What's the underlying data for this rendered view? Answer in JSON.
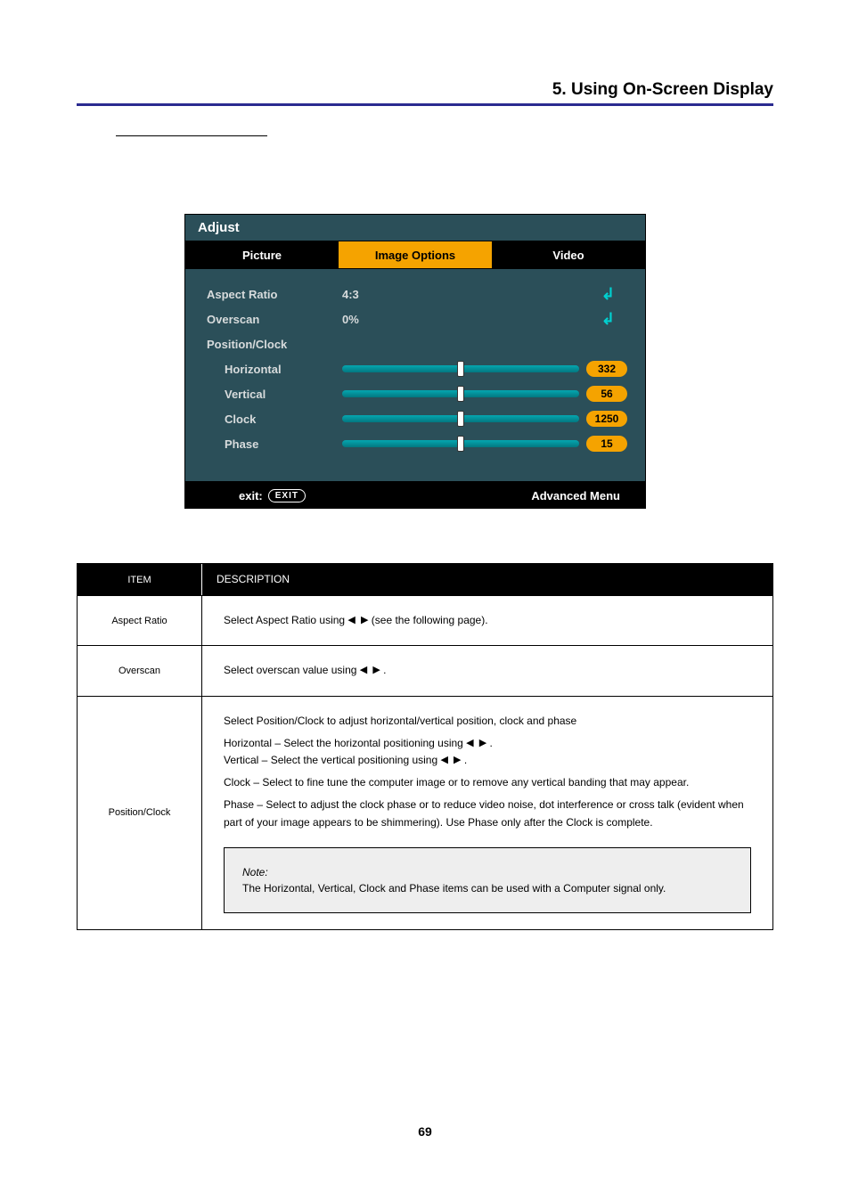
{
  "header": {
    "section_title": "5. Using On-Screen Display"
  },
  "osd": {
    "title": "Adjust",
    "tabs": [
      "Picture",
      "Image Options",
      "Video"
    ],
    "items": {
      "aspect_ratio": {
        "label": "Aspect Ratio",
        "value": "4:3"
      },
      "overscan": {
        "label": "Overscan",
        "value": "0%"
      },
      "position_clock": {
        "label": "Position/Clock"
      },
      "horizontal": {
        "label": "Horizontal",
        "value": "332"
      },
      "vertical": {
        "label": "Vertical",
        "value": "56"
      },
      "clock": {
        "label": "Clock",
        "value": "1250"
      },
      "phase": {
        "label": "Phase",
        "value": "15"
      }
    },
    "footer": {
      "exit_label": "exit:",
      "exit_button": "EXIT",
      "advanced": "Advanced Menu"
    },
    "icons": {
      "enter_glyph": "↲"
    }
  },
  "table": {
    "head": [
      "ITEM",
      "DESCRIPTION"
    ],
    "rows": [
      {
        "item": "Aspect Ratio",
        "desc_pre": "Select Aspect Ratio using ",
        "desc_post": " (see the following page)."
      },
      {
        "item": "Overscan",
        "desc_pre": "Select overscan value using ",
        "desc_post": "."
      },
      {
        "item": "Position/Clock",
        "lines": [
          "Select Position/Clock to adjust horizontal/vertical position, clock and phase",
          {
            "label_pre": "Horizontal – Select the horizontal positioning using ",
            "label_post": "."
          },
          {
            "label_pre": "Vertical – Select the vertical positioning using ",
            "label_post": "."
          },
          "Clock – Select to fine tune the computer image or to remove any vertical banding that may appear.",
          "Phase – Select to adjust the clock phase or to reduce video noise, dot interference or cross talk (evident when part of your image appears to be shimmering). Use Phase only after the Clock is complete."
        ],
        "note": {
          "prefix": "Note:",
          "body": "The Horizontal, Vertical, Clock and Phase items can be used with a Computer signal only."
        }
      }
    ]
  },
  "page_number": "69"
}
